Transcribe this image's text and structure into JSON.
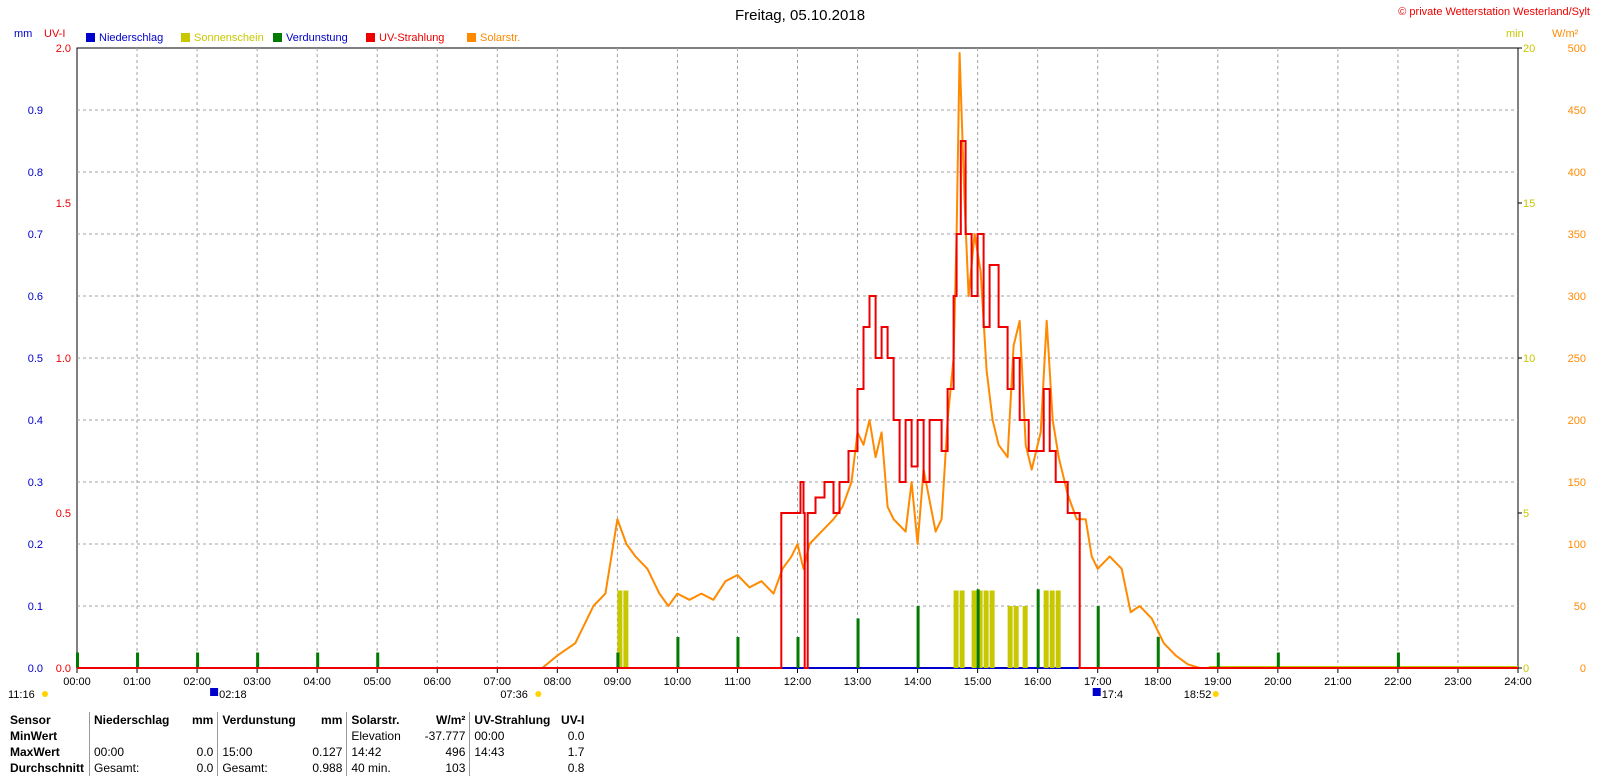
{
  "title": "Freitag, 05.10.2018",
  "copyright": "© private Wetterstation Westerland/Sylt",
  "colors": {
    "niederschlag": "#0000cc",
    "sonnenschein": "#c8c800",
    "verdunstung": "#007a00",
    "uv": "#ee0000",
    "solar": "#ff8a00",
    "grid": "#a0a0a0"
  },
  "chart_data": {
    "type": "line",
    "title": "Freitag, 05.10.2018",
    "x_range": [
      "00:00",
      "24:00"
    ],
    "x_ticks": [
      "00:00",
      "01:00",
      "02:00",
      "03:00",
      "04:00",
      "05:00",
      "06:00",
      "07:00",
      "08:00",
      "09:00",
      "10:00",
      "11:00",
      "12:00",
      "13:00",
      "14:00",
      "15:00",
      "16:00",
      "17:00",
      "18:00",
      "19:00",
      "20:00",
      "21:00",
      "22:00",
      "23:00",
      "24:00"
    ],
    "grid": true,
    "legend_position": "top-left",
    "axes": {
      "mm": {
        "label": "mm",
        "ylim": [
          0,
          1.0
        ],
        "ticks": [
          "0.0",
          "0.1",
          "0.2",
          "0.3",
          "0.4",
          "0.5",
          "0.6",
          "0.7",
          "0.8",
          "0.9"
        ]
      },
      "uv": {
        "label": "UV-I",
        "ylim": [
          0,
          2.0
        ],
        "ticks": [
          "0.0",
          "0.5",
          "1.0",
          "1.5",
          "2.0"
        ]
      },
      "min": {
        "label": "min",
        "ylim": [
          0,
          20
        ],
        "ticks": [
          "0",
          "5",
          "10",
          "15",
          "20"
        ]
      },
      "wm2": {
        "label": "W/m²",
        "ylim": [
          0,
          500
        ],
        "ticks": [
          "0",
          "50",
          "100",
          "150",
          "200",
          "250",
          "300",
          "350",
          "400",
          "450",
          "500"
        ]
      }
    },
    "markers": {
      "sunrise": "07:36",
      "sunset": "18:52",
      "moonrise": "02:18",
      "moonset": "17:4",
      "left_label": "11:16"
    },
    "series": [
      {
        "name": "Niederschlag",
        "axis": "mm",
        "color": "#0000cc",
        "points": [
          [
            0,
            0
          ],
          [
            24,
            0
          ]
        ]
      },
      {
        "name": "Sonnenschein",
        "axis": "min",
        "color": "#c8c800",
        "bars": [
          [
            9.0,
            2.5
          ],
          [
            9.1,
            2.5
          ],
          [
            14.6,
            2.5
          ],
          [
            14.7,
            2.5
          ],
          [
            14.9,
            2.5
          ],
          [
            15.0,
            2.5
          ],
          [
            15.1,
            2.5
          ],
          [
            15.2,
            2.5
          ],
          [
            15.5,
            2.0
          ],
          [
            15.6,
            2.0
          ],
          [
            15.75,
            2.0
          ],
          [
            16.1,
            2.5
          ],
          [
            16.2,
            2.5
          ],
          [
            16.3,
            2.5
          ]
        ]
      },
      {
        "name": "Verdunstung",
        "axis": "mm",
        "color": "#007a00",
        "bars": [
          [
            0,
            0.025
          ],
          [
            1,
            0.025
          ],
          [
            2,
            0.025
          ],
          [
            3,
            0.025
          ],
          [
            4,
            0.025
          ],
          [
            5,
            0.025
          ],
          [
            9,
            0.025
          ],
          [
            10,
            0.05
          ],
          [
            11,
            0.05
          ],
          [
            12,
            0.05
          ],
          [
            13,
            0.08
          ],
          [
            14,
            0.1
          ],
          [
            15,
            0.127
          ],
          [
            16,
            0.127
          ],
          [
            17,
            0.1
          ],
          [
            18,
            0.05
          ],
          [
            19,
            0.025
          ],
          [
            20,
            0.025
          ],
          [
            22,
            0.025
          ]
        ]
      },
      {
        "name": "UV-Strahlung",
        "axis": "uv",
        "color": "#ee0000",
        "points": [
          [
            0,
            0
          ],
          [
            11.72,
            0
          ],
          [
            11.73,
            0.5
          ],
          [
            12.0,
            0.5
          ],
          [
            12.05,
            0.6
          ],
          [
            12.1,
            0.5
          ],
          [
            12.12,
            0
          ],
          [
            12.15,
            0
          ],
          [
            12.17,
            0.5
          ],
          [
            12.3,
            0.55
          ],
          [
            12.45,
            0.6
          ],
          [
            12.6,
            0.5
          ],
          [
            12.7,
            0.6
          ],
          [
            12.85,
            0.7
          ],
          [
            13.0,
            0.9
          ],
          [
            13.1,
            1.1
          ],
          [
            13.2,
            1.2
          ],
          [
            13.3,
            1.0
          ],
          [
            13.4,
            1.1
          ],
          [
            13.5,
            1.0
          ],
          [
            13.6,
            0.8
          ],
          [
            13.7,
            0.6
          ],
          [
            13.8,
            0.8
          ],
          [
            13.9,
            0.65
          ],
          [
            14.0,
            0.8
          ],
          [
            14.1,
            0.6
          ],
          [
            14.2,
            0.8
          ],
          [
            14.4,
            0.7
          ],
          [
            14.5,
            0.9
          ],
          [
            14.6,
            1.2
          ],
          [
            14.65,
            1.4
          ],
          [
            14.72,
            1.7
          ],
          [
            14.8,
            1.4
          ],
          [
            14.9,
            1.2
          ],
          [
            15.0,
            1.4
          ],
          [
            15.1,
            1.1
          ],
          [
            15.2,
            1.3
          ],
          [
            15.35,
            1.1
          ],
          [
            15.5,
            0.9
          ],
          [
            15.6,
            1.0
          ],
          [
            15.7,
            0.8
          ],
          [
            15.85,
            0.7
          ],
          [
            16.0,
            0.7
          ],
          [
            16.1,
            0.9
          ],
          [
            16.2,
            0.7
          ],
          [
            16.3,
            0.6
          ],
          [
            16.45,
            0.6
          ],
          [
            16.5,
            0.5
          ],
          [
            16.68,
            0.5
          ],
          [
            16.7,
            0
          ],
          [
            24,
            0
          ]
        ]
      },
      {
        "name": "Solarstr.",
        "axis": "wm2",
        "color": "#ff8a00",
        "points": [
          [
            7.75,
            0
          ],
          [
            8.0,
            10
          ],
          [
            8.3,
            20
          ],
          [
            8.6,
            50
          ],
          [
            8.8,
            60
          ],
          [
            9.0,
            120
          ],
          [
            9.15,
            100
          ],
          [
            9.3,
            90
          ],
          [
            9.5,
            80
          ],
          [
            9.7,
            60
          ],
          [
            9.85,
            50
          ],
          [
            10.0,
            60
          ],
          [
            10.2,
            55
          ],
          [
            10.4,
            60
          ],
          [
            10.6,
            55
          ],
          [
            10.8,
            70
          ],
          [
            11.0,
            75
          ],
          [
            11.2,
            65
          ],
          [
            11.4,
            70
          ],
          [
            11.6,
            60
          ],
          [
            11.75,
            80
          ],
          [
            11.9,
            90
          ],
          [
            12.0,
            100
          ],
          [
            12.1,
            80
          ],
          [
            12.2,
            100
          ],
          [
            12.4,
            110
          ],
          [
            12.6,
            120
          ],
          [
            12.75,
            130
          ],
          [
            12.9,
            150
          ],
          [
            13.0,
            190
          ],
          [
            13.1,
            180
          ],
          [
            13.2,
            200
          ],
          [
            13.3,
            170
          ],
          [
            13.4,
            190
          ],
          [
            13.5,
            130
          ],
          [
            13.6,
            120
          ],
          [
            13.8,
            110
          ],
          [
            13.9,
            150
          ],
          [
            14.0,
            100
          ],
          [
            14.1,
            160
          ],
          [
            14.3,
            110
          ],
          [
            14.4,
            120
          ],
          [
            14.5,
            200
          ],
          [
            14.6,
            250
          ],
          [
            14.65,
            350
          ],
          [
            14.7,
            496
          ],
          [
            14.78,
            380
          ],
          [
            14.85,
            300
          ],
          [
            14.95,
            350
          ],
          [
            15.05,
            320
          ],
          [
            15.15,
            240
          ],
          [
            15.25,
            200
          ],
          [
            15.35,
            180
          ],
          [
            15.5,
            170
          ],
          [
            15.6,
            260
          ],
          [
            15.7,
            280
          ],
          [
            15.8,
            180
          ],
          [
            15.9,
            160
          ],
          [
            16.05,
            190
          ],
          [
            16.15,
            280
          ],
          [
            16.25,
            200
          ],
          [
            16.35,
            170
          ],
          [
            16.5,
            140
          ],
          [
            16.65,
            120
          ],
          [
            16.8,
            120
          ],
          [
            16.9,
            90
          ],
          [
            17.0,
            80
          ],
          [
            17.2,
            90
          ],
          [
            17.4,
            80
          ],
          [
            17.55,
            45
          ],
          [
            17.7,
            50
          ],
          [
            17.9,
            40
          ],
          [
            18.1,
            20
          ],
          [
            18.3,
            10
          ],
          [
            18.5,
            3
          ],
          [
            18.7,
            0
          ]
        ]
      }
    ]
  },
  "stats": {
    "headers": {
      "sensor": "Sensor",
      "niederschlag": "Niederschlag",
      "niederschlag_unit": "mm",
      "verdunstung": "Verdunstung",
      "verdunstung_unit": "mm",
      "solar": "Solarstr.",
      "solar_unit": "W/m²",
      "uv": "UV-Strahlung",
      "uv_unit": "UV-I"
    },
    "minwert": {
      "label": "MinWert",
      "solar_desc": "Elevation",
      "solar_val": "-37.777",
      "uv_time": "00:00",
      "uv_val": "0.0"
    },
    "maxwert": {
      "label": "MaxWert",
      "nied_time": "00:00",
      "nied_val": "0.0",
      "verd_time": "15:00",
      "verd_val": "0.127",
      "solar_time": "14:42",
      "solar_val": "496",
      "uv_time": "14:43",
      "uv_val": "1.7"
    },
    "durchschnitt": {
      "label": "Durchschnitt",
      "nied_desc": "Gesamt:",
      "nied_val": "0.0",
      "verd_desc": "Gesamt:",
      "verd_val": "0.988",
      "solar_desc": "40 min.",
      "solar_val": "103",
      "uv_val": "0.8"
    }
  }
}
